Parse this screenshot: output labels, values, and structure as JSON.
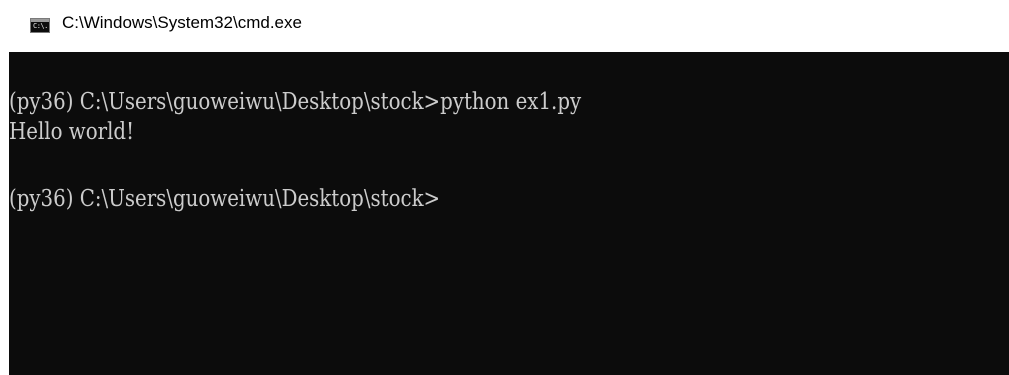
{
  "window": {
    "title": "C:\\Windows\\System32\\cmd.exe",
    "icon": "console-icon",
    "icon_text": "C:\\."
  },
  "console": {
    "lines": [
      "(py36) C:\\Users\\guoweiwu\\Desktop\\stock>python ex1.py",
      "Hello world!",
      "(py36) C:\\Users\\guoweiwu\\Desktop\\stock>"
    ]
  },
  "colors": {
    "console_background": "#0c0c0c",
    "console_text": "#cccccc",
    "titlebar_background": "#ffffff"
  }
}
